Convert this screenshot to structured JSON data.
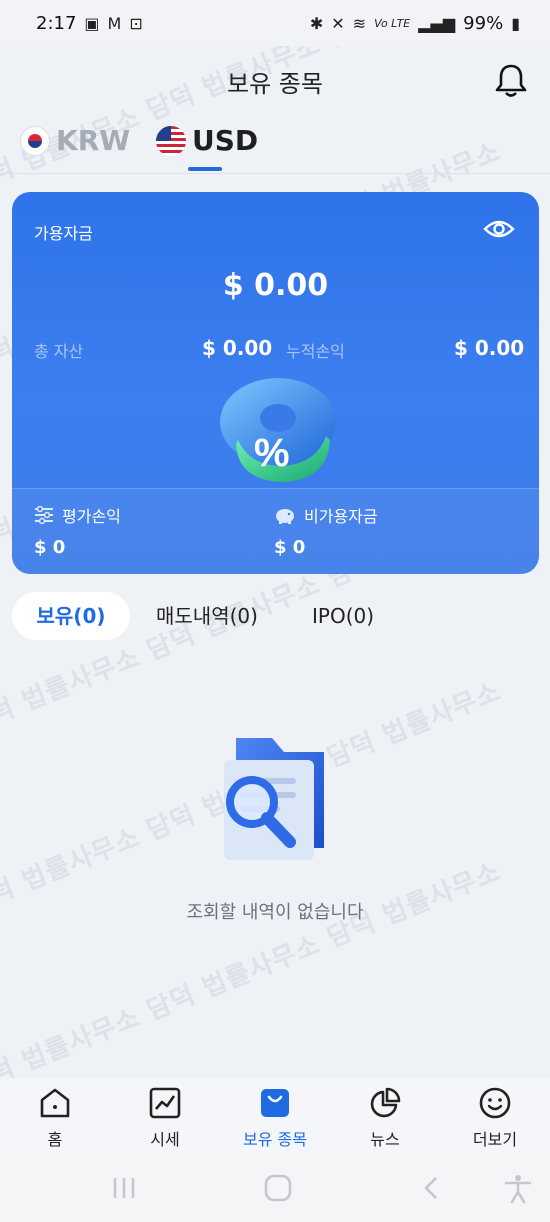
{
  "status_bar": {
    "time": "2:17",
    "battery": "99%",
    "network": "Vo LTE"
  },
  "header": {
    "title": "보유 종목"
  },
  "currency_tabs": [
    {
      "label": "KRW",
      "active": false
    },
    {
      "label": "USD",
      "active": true
    }
  ],
  "card": {
    "available_label": "가용자금",
    "available_amount": "$ 0.00",
    "total_assets_label": "총 자산",
    "total_assets_value": "$ 0.00",
    "cumulative_pl_label": "누적손익",
    "cumulative_pl_value": "$ 0.00",
    "valuation_pl_label": "평가손익",
    "valuation_pl_value": "$ 0",
    "unavailable_label": "비가용자금",
    "unavailable_value": "$ 0"
  },
  "holding_tabs": [
    {
      "label": "보유(0)",
      "active": true
    },
    {
      "label": "매도내역(0)",
      "active": false
    },
    {
      "label": "IPO(0)",
      "active": false
    }
  ],
  "empty_state": {
    "message": "조회할 내역이 없습니다"
  },
  "bottom_nav": [
    {
      "label": "홈",
      "icon": "home-icon",
      "active": false
    },
    {
      "label": "시세",
      "icon": "chart-icon",
      "active": false
    },
    {
      "label": "보유 종목",
      "icon": "bag-icon",
      "active": true
    },
    {
      "label": "뉴스",
      "icon": "pie-chart-icon",
      "active": false
    },
    {
      "label": "더보기",
      "icon": "smile-icon",
      "active": false
    }
  ],
  "watermark_text": "담덕 법률사무소",
  "colors": {
    "accent": "#1f6be0",
    "card_blue": "#3a7ae8",
    "background": "#eef2f7"
  }
}
